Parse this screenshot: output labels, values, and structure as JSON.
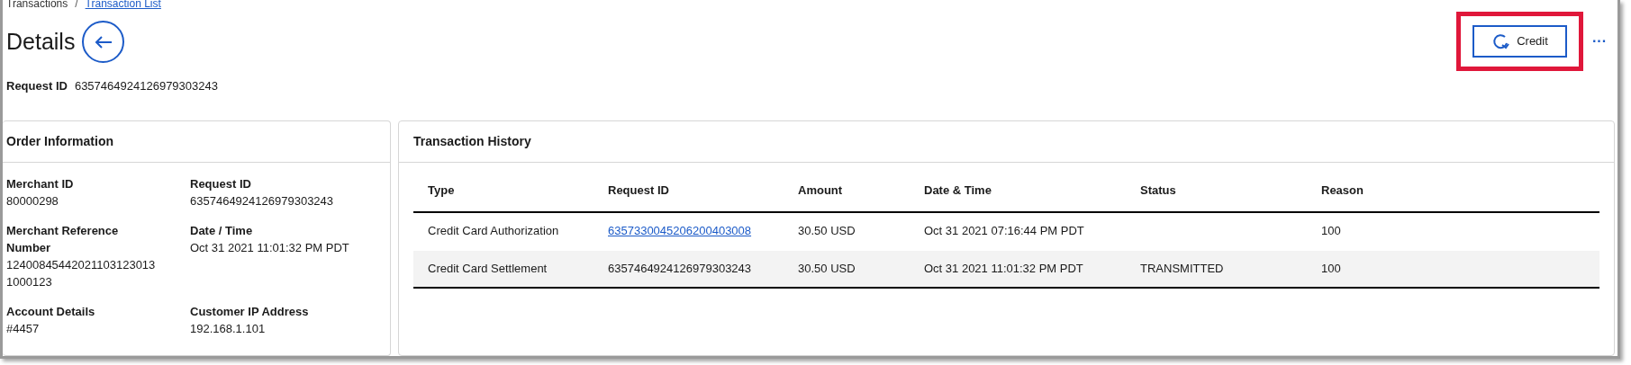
{
  "breadcrumb": [
    {
      "label": "Transactions",
      "link": false
    },
    {
      "label": "Transaction List",
      "link": true
    }
  ],
  "breadcrumb_separator": "/",
  "title": "Details",
  "request_id": {
    "label": "Request ID",
    "value": "6357464924126979303243"
  },
  "actions": {
    "credit_label": "Credit",
    "highlighted": true,
    "more": "···"
  },
  "order_information": {
    "title": "Order Information",
    "fields": [
      {
        "label": "Merchant ID",
        "value": "80000298"
      },
      {
        "label": "Request ID",
        "value": "6357464924126979303243"
      },
      {
        "label": "Merchant Reference Number",
        "value": "12400845442021103123013 1000123"
      },
      {
        "label": "Date / Time",
        "value": "Oct 31 2021 11:01:32 PM PDT"
      },
      {
        "label": "Account Details",
        "value": "#4457"
      },
      {
        "label": "Customer IP Address",
        "value": "192.168.1.101"
      }
    ]
  },
  "transaction_history": {
    "title": "Transaction History",
    "columns": [
      "Type",
      "Request ID",
      "Amount",
      "Date & Time",
      "Status",
      "Reason"
    ],
    "rows": [
      {
        "type": "Credit Card Authorization",
        "request_id": "6357330045206200403008",
        "request_id_link": true,
        "amount": "30.50 USD",
        "date_time": "Oct 31 2021 07:16:44 PM PDT",
        "status": "",
        "reason": "100",
        "shaded": false
      },
      {
        "type": "Credit Card Settlement",
        "request_id": "6357464924126979303243",
        "request_id_link": false,
        "amount": "30.50 USD",
        "date_time": "Oct 31 2021 11:01:32 PM PDT",
        "status": "TRANSMITTED",
        "reason": "100",
        "shaded": true
      }
    ]
  }
}
